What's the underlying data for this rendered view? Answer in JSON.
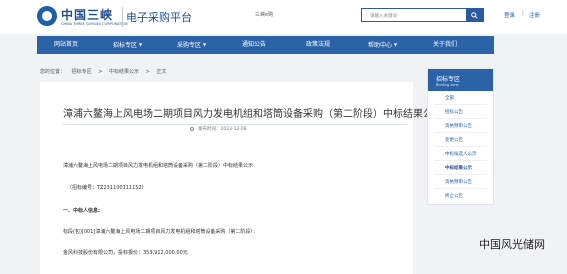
{
  "header": {
    "logo_cn": "中国三峡",
    "logo_en": "CHINA THREE GORGES CORPORATION",
    "platform": "电子采购平台",
    "center_text": "三峡e购",
    "search_placeholder": "请输入关键词",
    "login": "登录",
    "sep": "|",
    "register": "注册"
  },
  "nav": {
    "items": [
      {
        "label": "网站首页",
        "caret": ""
      },
      {
        "label": "招标专区",
        "caret": "▼"
      },
      {
        "label": "采购专区",
        "caret": "▼"
      },
      {
        "label": "通知公告",
        "caret": ""
      },
      {
        "label": "政策法规",
        "caret": ""
      },
      {
        "label": "帮助中心",
        "caret": "▼"
      },
      {
        "label": "关于我们",
        "caret": ""
      }
    ]
  },
  "breadcrumb": [
    "您的位置：",
    "招标专区",
    ">",
    "中标结果公示",
    ">",
    "正文"
  ],
  "article": {
    "title": "漳浦六鳌海上风电场二期项目风力发电机组和塔筒设备采购（第二阶段）中标结果公示",
    "date_label": "发布时间：",
    "date": "2023-12-08",
    "para1": "漳浦六鳌海上风电场二期项目风力发电机组和塔筒设备采购（第二阶段）中标结果公示",
    "para2": "（招标编号：TZ231100111152）",
    "para3": "一、中标人信息:",
    "para4": "标段(包)[001]漳浦六鳌海上风电场二期项目风力发电机组和塔筒设备采购（第二阶段）：",
    "para5": "金风科技股份有限公司，投标报价：353,912,000.00元"
  },
  "sidebar": {
    "title": "招标专区",
    "subtitle": "Bidding zone",
    "items": [
      "全部",
      "招标公告",
      "资格预审公告",
      "变更公告",
      "中标候选人公示",
      "中标结果公示",
      "资格预审公告",
      "终止公告"
    ],
    "active_index": 5
  },
  "watermark": "中国风光储网",
  "colors": {
    "nav": "#2c63a8",
    "accent": "#1f5ea8"
  }
}
